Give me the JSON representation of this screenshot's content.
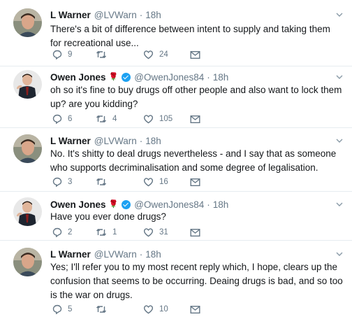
{
  "tweets": [
    {
      "name": "L Warner",
      "handle": "@LVWarn",
      "dot": "·",
      "time": "18h",
      "verified": false,
      "rose": false,
      "text": "There's a bit of difference between intent to supply and taking them for recreational use...",
      "replies": "9",
      "retweets": "",
      "likes": "24",
      "icons": [
        "reply-icon",
        "retweet-icon",
        "like-icon",
        "message-icon"
      ]
    },
    {
      "name": "Owen Jones",
      "rose_glyph": "🌹",
      "handle": "@OwenJones84",
      "dot": "·",
      "time": "18h",
      "verified": true,
      "rose": true,
      "text": "oh so it's fine to buy drugs off other people and also want to lock them up? are you kidding?",
      "replies": "6",
      "retweets": "4",
      "likes": "105",
      "icons": [
        "reply-icon",
        "retweet-icon",
        "like-icon",
        "message-icon"
      ]
    },
    {
      "name": "L Warner",
      "handle": "@LVWarn",
      "dot": "·",
      "time": "18h",
      "verified": false,
      "rose": false,
      "text": "No. It's shitty to deal drugs nevertheless - and I say that as someone who supports decriminalisation and some degree of legalisation.",
      "replies": "3",
      "retweets": "",
      "likes": "16",
      "icons": [
        "reply-icon",
        "retweet-icon",
        "like-icon",
        "message-icon"
      ]
    },
    {
      "name": "Owen Jones",
      "rose_glyph": "🌹",
      "handle": "@OwenJones84",
      "dot": "·",
      "time": "18h",
      "verified": true,
      "rose": true,
      "text": "Have you ever done drugs?",
      "replies": "2",
      "retweets": "1",
      "likes": "31",
      "icons": [
        "reply-icon",
        "retweet-icon",
        "like-icon",
        "message-icon"
      ]
    },
    {
      "name": "L Warner",
      "handle": "@LVWarn",
      "dot": "·",
      "time": "18h",
      "verified": false,
      "rose": false,
      "text": "Yes; I'll refer you to my most recent reply which, I hope, clears up the confusion that seems to be occurring. Deaing drugs is bad, and so too is the war on drugs.",
      "replies": "5",
      "retweets": "",
      "likes": "10",
      "icons": [
        "reply-icon",
        "retweet-icon",
        "like-icon",
        "message-icon"
      ]
    }
  ],
  "colors": {
    "text": "#14171a",
    "muted": "#657786",
    "verified": "#1da1f2",
    "separator": "#e6ecf0"
  }
}
